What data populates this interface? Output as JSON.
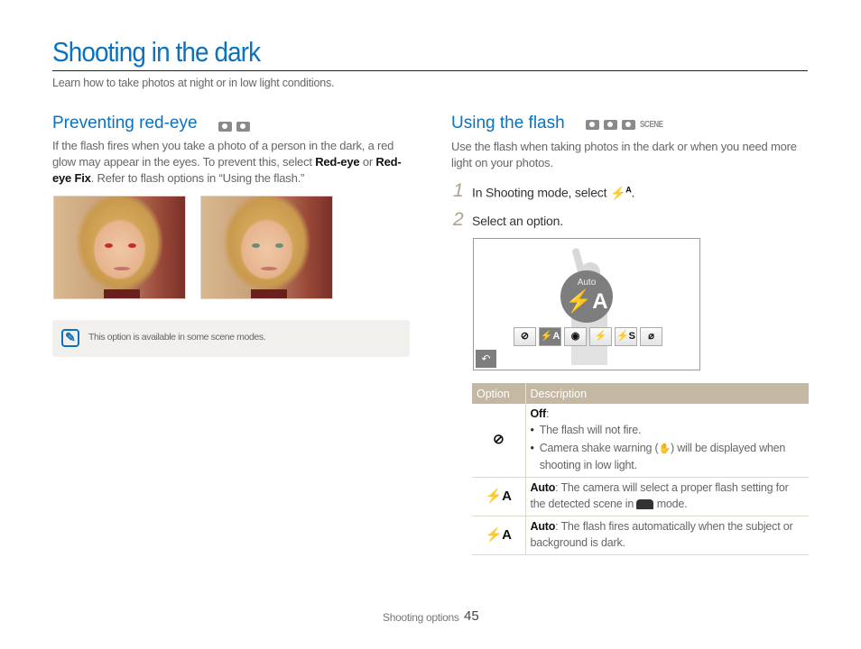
{
  "page": {
    "title": "Shooting in the dark",
    "subtitle": "Learn how to take photos at night or in low light conditions."
  },
  "red_eye": {
    "heading": "Preventing red-eye",
    "mode_icons": [
      "program-mode-icon",
      "dual-is-mode-icon"
    ],
    "text_before": "If the flash fires when you take a photo of a person in the dark, a red glow may appear in the eyes. To prevent this, select ",
    "bold1": "Red-eye",
    "text_mid": " or ",
    "bold2": "Red-eye Fix",
    "text_after": ". Refer to flash options in “Using the flash.”",
    "photos": [
      {
        "name": "red-eye-photo",
        "eye_color": "#c0302a"
      },
      {
        "name": "red-eye-fixed-photo",
        "eye_color": "#6f8a7c"
      }
    ],
    "note": {
      "icon": "note-pencil-icon",
      "text": "This option is available in some scene modes."
    }
  },
  "flash": {
    "heading": "Using the flash",
    "mode_icons": [
      "smart-auto-mode-icon",
      "program-mode-icon",
      "dual-is-mode-icon"
    ],
    "mode_scene_label": "SCENE",
    "intro": "Use the flash when taking photos in the dark or when you need more light on your photos.",
    "steps": [
      {
        "num": "1",
        "text": "In Shooting mode, select ",
        "glyph": "⚡",
        "glyph_sup": "A",
        "suffix": "."
      },
      {
        "num": "2",
        "text": "Select an option."
      }
    ],
    "screen": {
      "selected_label": "Auto",
      "selected_glyph": "⚡A",
      "options": [
        {
          "name": "flash-off-icon",
          "glyph": "⊘"
        },
        {
          "name": "flash-auto-icon",
          "glyph": "⚡A",
          "selected": true
        },
        {
          "name": "red-eye-icon",
          "glyph": "👁"
        },
        {
          "name": "fill-in-flash-icon",
          "glyph": "⚡"
        },
        {
          "name": "slow-sync-icon",
          "glyph": "⚡S"
        },
        {
          "name": "red-eye-fix-icon",
          "glyph": "⌀"
        }
      ],
      "back_glyph": "↶"
    },
    "table": {
      "headers": [
        "Option",
        "Description"
      ],
      "rows": [
        {
          "icon": "flash-off-icon",
          "glyph": "⊘",
          "title": "Off",
          "bullets": [
            "The flash will not fire.",
            "Camera shake warning ( ) will be displayed when shooting in low light."
          ],
          "bullet2_before": "Camera shake warning (",
          "bullet2_icon": "camera-shake-warning-icon",
          "bullet2_after": ") will be displayed when shooting in low light."
        },
        {
          "icon": "smart-flash-auto-icon",
          "glyph": "⚡A",
          "title": "Auto",
          "desc_before": ": The camera will select a proper flash setting for the detected scene in ",
          "desc_icon": "smart-auto-mode-icon",
          "desc_after": " mode."
        },
        {
          "icon": "flash-auto-icon",
          "glyph": "⚡A",
          "title": "Auto",
          "desc": ": The flash fires automatically when the subject or background is dark."
        }
      ]
    }
  },
  "footer": {
    "section": "Shooting options",
    "page_number": "45"
  },
  "colors": {
    "accent_blue": "#0a72bf",
    "table_header": "#c4b8a2",
    "note_bg": "#f2f0ed",
    "step_number": "#b0a38c"
  }
}
